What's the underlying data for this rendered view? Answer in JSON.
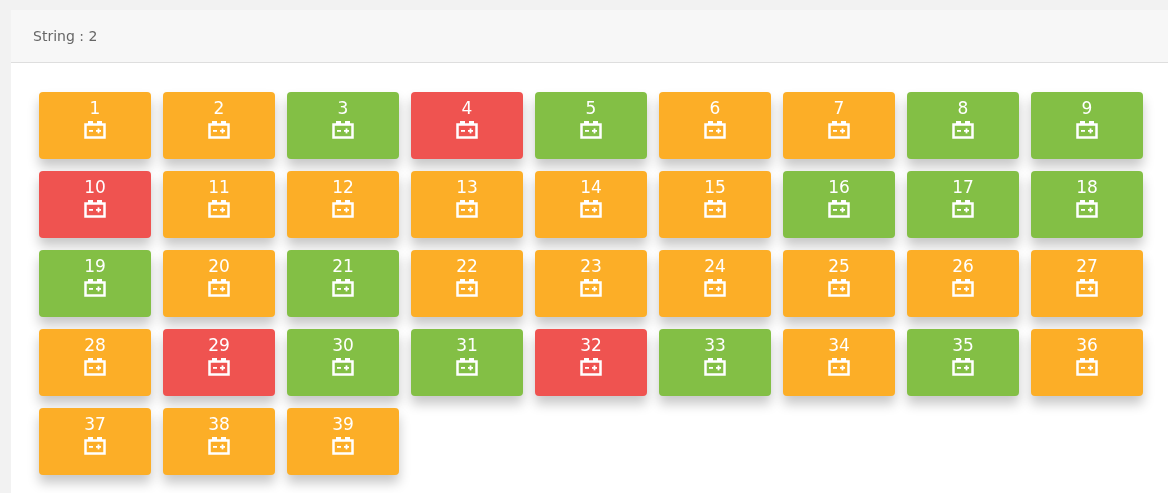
{
  "header": {
    "title": "String : 2"
  },
  "batteries": [
    {
      "label": "1",
      "color": "#fcae27"
    },
    {
      "label": "2",
      "color": "#fcae27"
    },
    {
      "label": "3",
      "color": "#83bf45"
    },
    {
      "label": "4",
      "color": "#ef5350"
    },
    {
      "label": "5",
      "color": "#83bf45"
    },
    {
      "label": "6",
      "color": "#fcae27"
    },
    {
      "label": "7",
      "color": "#fcae27"
    },
    {
      "label": "8",
      "color": "#83bf45"
    },
    {
      "label": "9",
      "color": "#83bf45"
    },
    {
      "label": "10",
      "color": "#ef5350"
    },
    {
      "label": "11",
      "color": "#fcae27"
    },
    {
      "label": "12",
      "color": "#fcae27"
    },
    {
      "label": "13",
      "color": "#fcae27"
    },
    {
      "label": "14",
      "color": "#fcae27"
    },
    {
      "label": "15",
      "color": "#fcae27"
    },
    {
      "label": "16",
      "color": "#83bf45"
    },
    {
      "label": "17",
      "color": "#83bf45"
    },
    {
      "label": "18",
      "color": "#83bf45"
    },
    {
      "label": "19",
      "color": "#83bf45"
    },
    {
      "label": "20",
      "color": "#fcae27"
    },
    {
      "label": "21",
      "color": "#83bf45"
    },
    {
      "label": "22",
      "color": "#fcae27"
    },
    {
      "label": "23",
      "color": "#fcae27"
    },
    {
      "label": "24",
      "color": "#fcae27"
    },
    {
      "label": "25",
      "color": "#fcae27"
    },
    {
      "label": "26",
      "color": "#fcae27"
    },
    {
      "label": "27",
      "color": "#fcae27"
    },
    {
      "label": "28",
      "color": "#fcae27"
    },
    {
      "label": "29",
      "color": "#ef5350"
    },
    {
      "label": "30",
      "color": "#83bf45"
    },
    {
      "label": "31",
      "color": "#83bf45"
    },
    {
      "label": "32",
      "color": "#ef5350"
    },
    {
      "label": "33",
      "color": "#83bf45"
    },
    {
      "label": "34",
      "color": "#fcae27"
    },
    {
      "label": "35",
      "color": "#83bf45"
    },
    {
      "label": "36",
      "color": "#fcae27"
    },
    {
      "label": "37",
      "color": "#fcae27"
    },
    {
      "label": "38",
      "color": "#fcae27"
    },
    {
      "label": "39",
      "color": "#fcae27"
    }
  ]
}
